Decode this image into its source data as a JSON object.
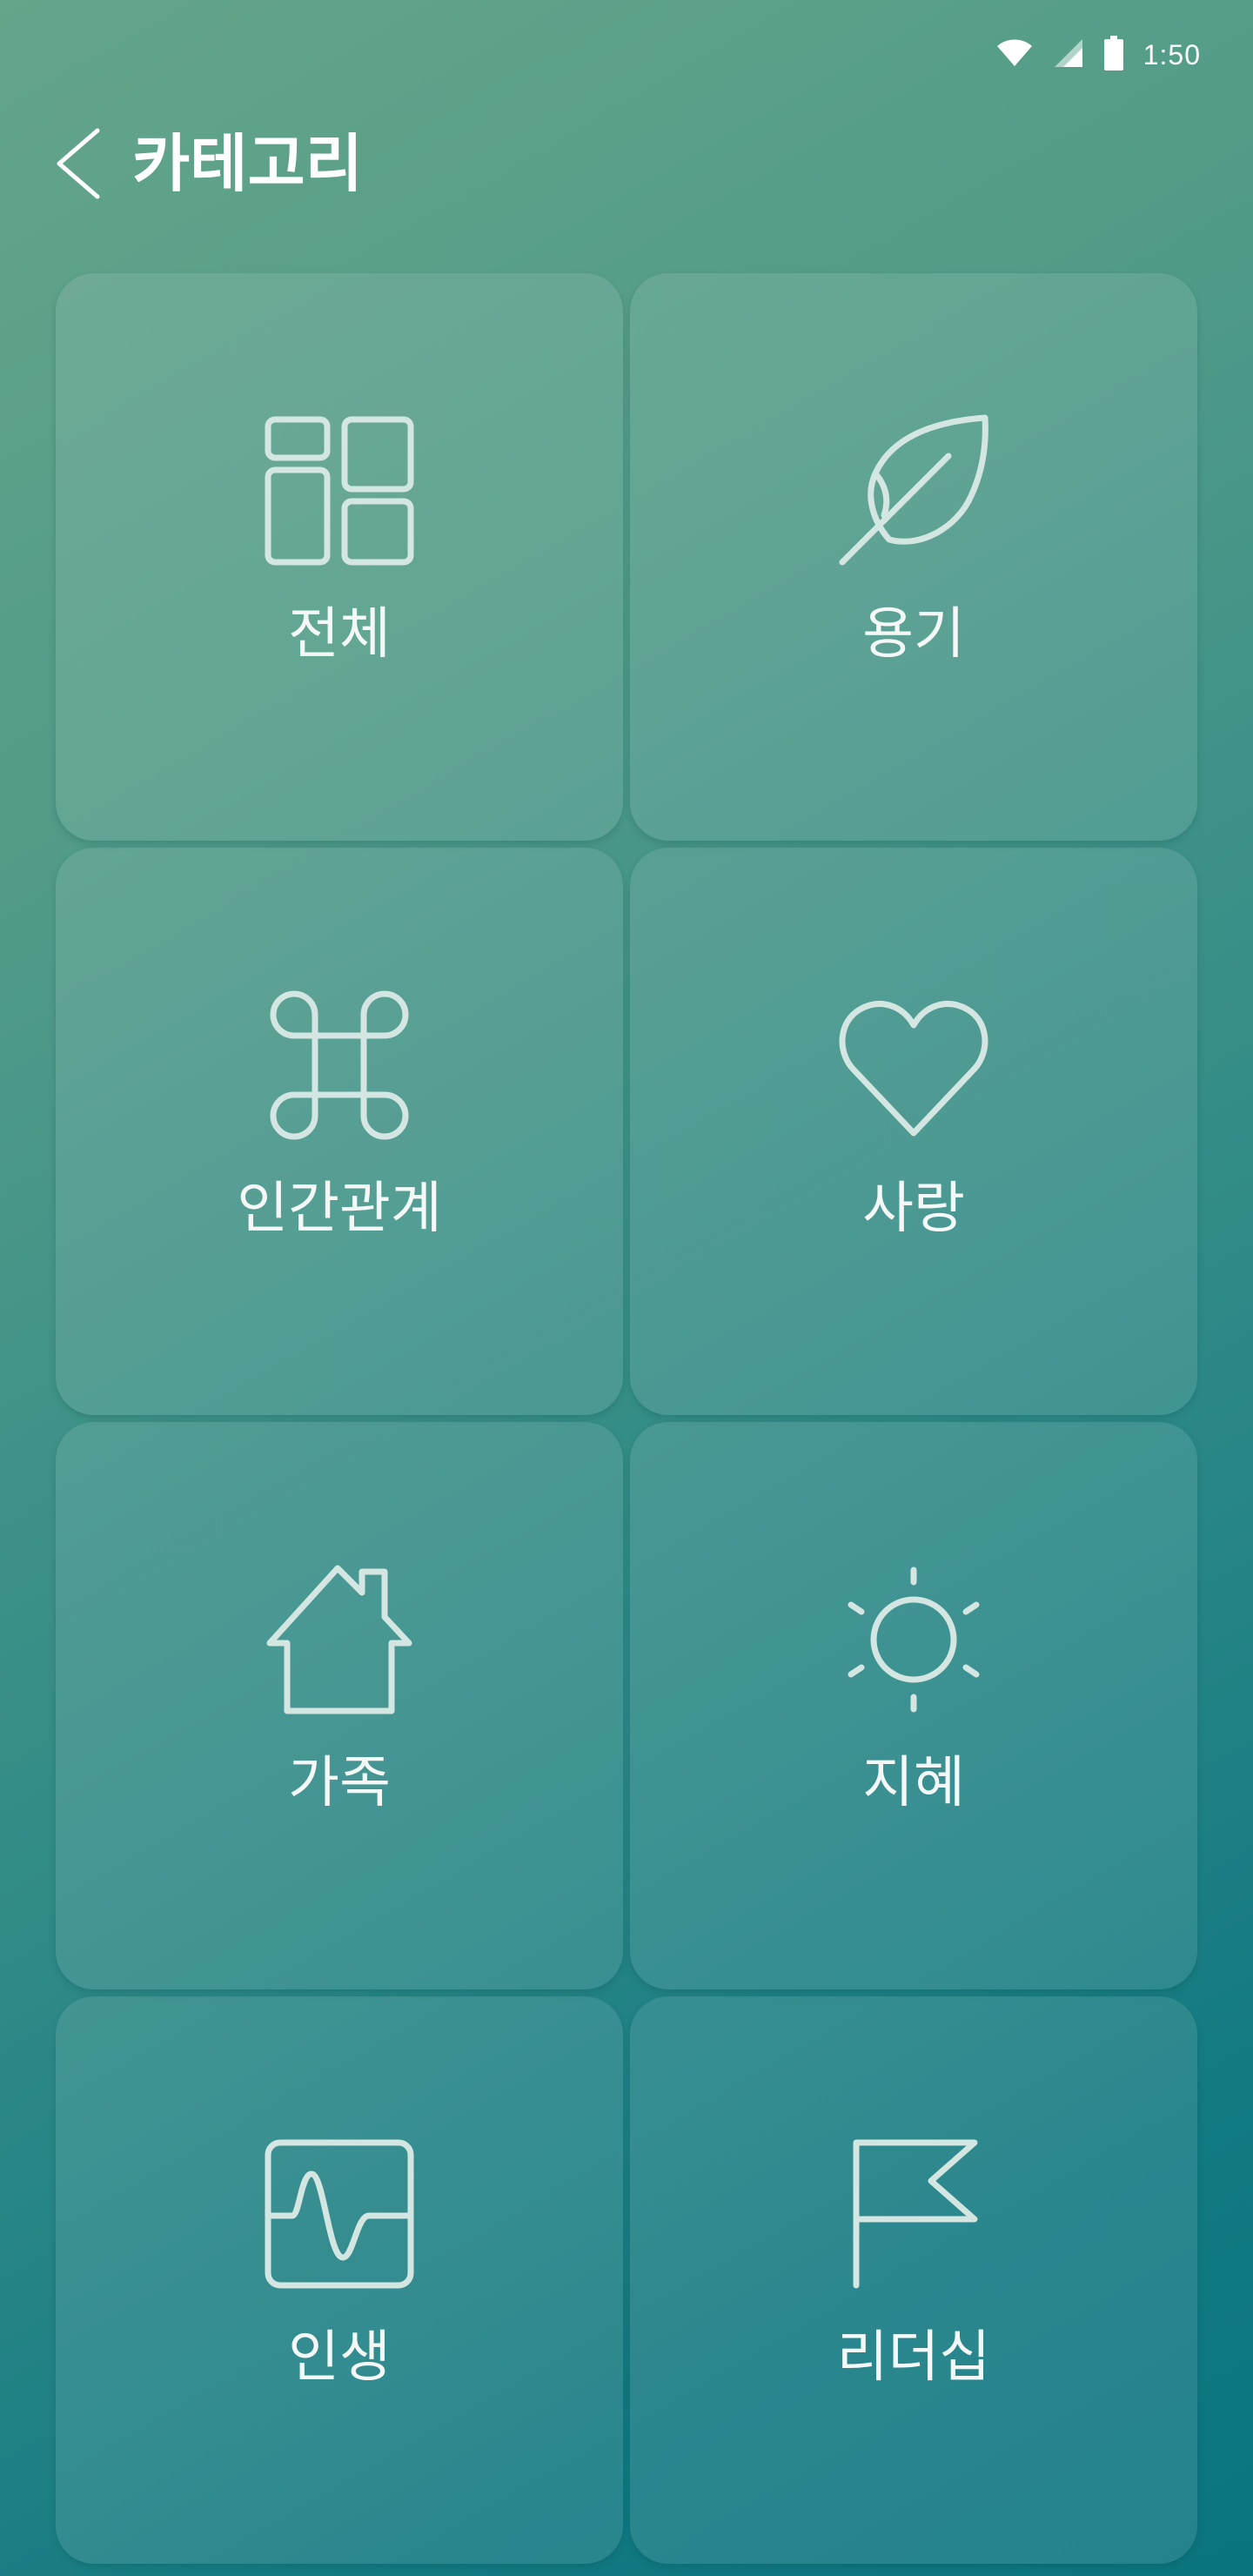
{
  "status_bar": {
    "time": "1:50",
    "icons": [
      "wifi-icon",
      "cellular-signal-icon",
      "battery-icon"
    ]
  },
  "header": {
    "back_icon": "chevron-left-icon",
    "title": "카테고리"
  },
  "categories": [
    {
      "label": "전체",
      "icon": "grid-layout-icon"
    },
    {
      "label": "용기",
      "icon": "feather-icon"
    },
    {
      "label": "인간관계",
      "icon": "command-icon"
    },
    {
      "label": "사랑",
      "icon": "heart-icon"
    },
    {
      "label": "가족",
      "icon": "house-icon"
    },
    {
      "label": "지혜",
      "icon": "sun-icon"
    },
    {
      "label": "인생",
      "icon": "pulse-chart-icon"
    },
    {
      "label": "리더십",
      "icon": "flag-icon"
    }
  ],
  "colors": {
    "gradient_start": "#65a58a",
    "gradient_end": "#0b747d",
    "icon_stroke": "#d3e6e2",
    "text": "#ffffff"
  }
}
